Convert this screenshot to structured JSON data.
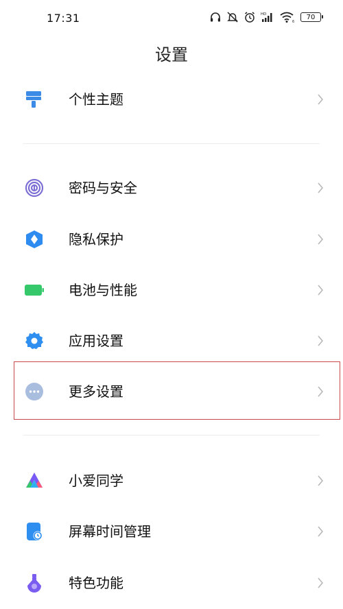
{
  "status_bar": {
    "time": "17:31",
    "battery": "70",
    "icons": [
      "headphones-icon",
      "mute-bell-icon",
      "alarm-icon",
      "signal-icon",
      "wifi-icon",
      "battery-icon"
    ]
  },
  "header": {
    "title": "设置"
  },
  "rows": [
    {
      "label": "个性主题",
      "icon": "theme-brush-icon",
      "icon_color": "#3b8be6"
    },
    {
      "label": "密码与安全",
      "icon": "fingerprint-icon",
      "icon_color": "#7b6fd6"
    },
    {
      "label": "隐私保护",
      "icon": "privacy-shield-icon",
      "icon_color": "#2e8cf0"
    },
    {
      "label": "电池与性能",
      "icon": "battery-performance-icon",
      "icon_color": "#35c86a"
    },
    {
      "label": "应用设置",
      "icon": "gear-icon",
      "icon_color": "#2f8ff0"
    },
    {
      "label": "更多设置",
      "icon": "more-dots-icon",
      "icon_color": "#a9bddf"
    },
    {
      "label": "小爱同学",
      "icon": "xiaoai-icon",
      "icon_color": "#7a5af5"
    },
    {
      "label": "屏幕时间管理",
      "icon": "screen-time-icon",
      "icon_color": "#2f8ff0"
    },
    {
      "label": "特色功能",
      "icon": "special-feature-icon",
      "icon_color": "#7b5cf0"
    }
  ],
  "highlighted_row": "更多设置"
}
